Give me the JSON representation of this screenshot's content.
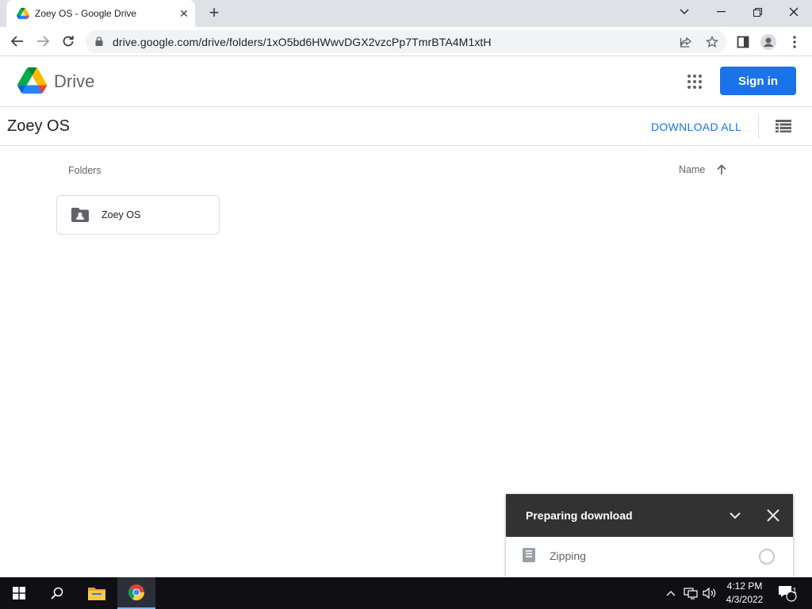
{
  "browser": {
    "tab_title": "Zoey OS - Google Drive",
    "url": "drive.google.com/drive/folders/1xO5bd6HWwvDGX2vzcPp7TmrBTA4M1xtH"
  },
  "drive": {
    "app_name": "Drive",
    "signin_label": "Sign in",
    "folder_title": "Zoey OS",
    "download_all_label": "DOWNLOAD ALL",
    "section_label": "Folders",
    "sort_label": "Name",
    "folders": [
      {
        "name": "Zoey OS"
      }
    ]
  },
  "toast": {
    "title": "Preparing download",
    "item_label": "Zipping"
  },
  "taskbar": {
    "time": "4:12 PM",
    "date": "4/3/2022",
    "notification_count": "1"
  },
  "colors": {
    "accent": "#1a73e8",
    "toast_bg": "#323232",
    "taskbar_bg": "#0f0f14"
  }
}
